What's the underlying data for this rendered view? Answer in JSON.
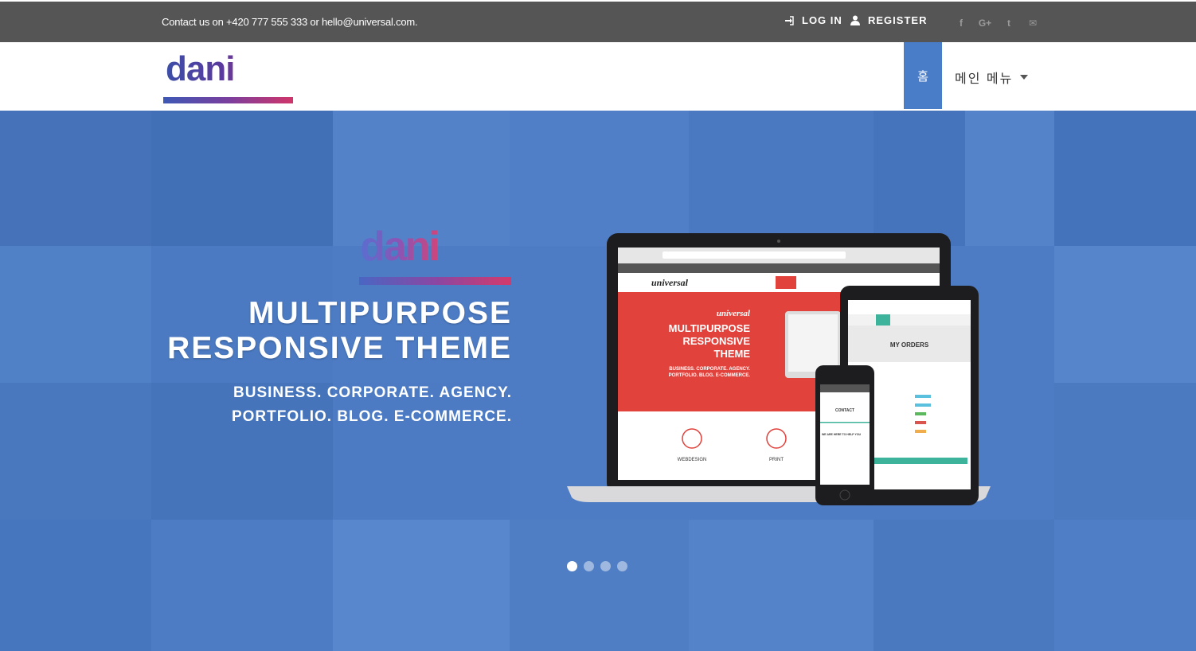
{
  "topbar": {
    "contact_text": "Contact us on +420 777 555 333 or hello@universal.com.",
    "login_label": "LOG IN",
    "register_label": "REGISTER",
    "social": [
      "f",
      "G+",
      "t",
      "✉"
    ]
  },
  "navbar": {
    "logo_text": "dani",
    "home_label": "홈",
    "main_menu_label": "메인 메뉴"
  },
  "hero": {
    "logo_text": "dani",
    "title_line1": "MULTIPURPOSE",
    "title_line2": "RESPONSIVE THEME",
    "sub_line1": "BUSINESS. CORPORATE. AGENCY.",
    "sub_line2": "PORTFOLIO. BLOG. E-COMMERCE.",
    "mockup": {
      "brand": "universal",
      "headline1": "MULTIPURPOSE",
      "headline2": "RESPONSIVE",
      "headline3": "THEME",
      "tagline1": "BUSINESS. CORPORATE. AGENCY.",
      "tagline2": "PORTFOLIO. BLOG. E-COMMERCE.",
      "service1": "WEBDESIGN",
      "service2": "PRINT",
      "tablet_heading": "MY ORDERS",
      "phone_heading": "CONTACT",
      "phone_sub": "WE ARE HERE TO HELP YOU"
    }
  },
  "slider": {
    "count": 4,
    "active": 0
  },
  "colors": {
    "accent": "#4a7dc7",
    "topbar": "#555555",
    "hero_bg": "#4d7cc5",
    "mock_red": "#e2423c"
  }
}
